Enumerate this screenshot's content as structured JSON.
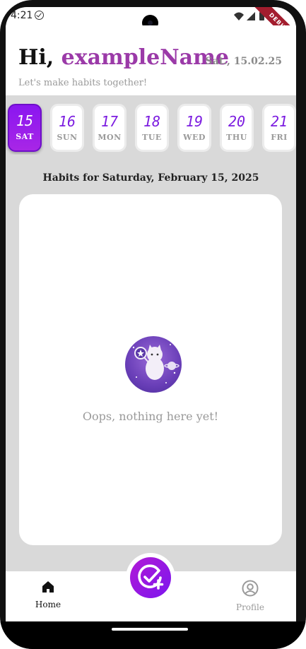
{
  "status_bar": {
    "time": "4:21",
    "debug_label": "DEBUG"
  },
  "header": {
    "greeting_prefix": "Hi, ",
    "user_name": "exampleName",
    "date_label": "Sat., 15.02.25",
    "subtitle": "Let's make habits together!"
  },
  "days": [
    {
      "number": "15",
      "weekday": "SAT",
      "selected": true
    },
    {
      "number": "16",
      "weekday": "SUN",
      "selected": false
    },
    {
      "number": "17",
      "weekday": "MON",
      "selected": false
    },
    {
      "number": "18",
      "weekday": "TUE",
      "selected": false
    },
    {
      "number": "19",
      "weekday": "WED",
      "selected": false
    },
    {
      "number": "20",
      "weekday": "THU",
      "selected": false
    },
    {
      "number": "21",
      "weekday": "FRI",
      "selected": false
    }
  ],
  "habits": {
    "title": "Habits for Saturday, February 15, 2025",
    "empty_message": "Oops, nothing here yet!"
  },
  "nav": {
    "home_label": "Home",
    "profile_label": "Profile",
    "active": "home"
  },
  "colors": {
    "accent": "#8a16f0",
    "name": "#9b3aa8",
    "background": "#d9d9d9"
  },
  "icons": {
    "home": "home-icon",
    "profile": "profile-icon",
    "add_habit": "add-habit-icon"
  }
}
